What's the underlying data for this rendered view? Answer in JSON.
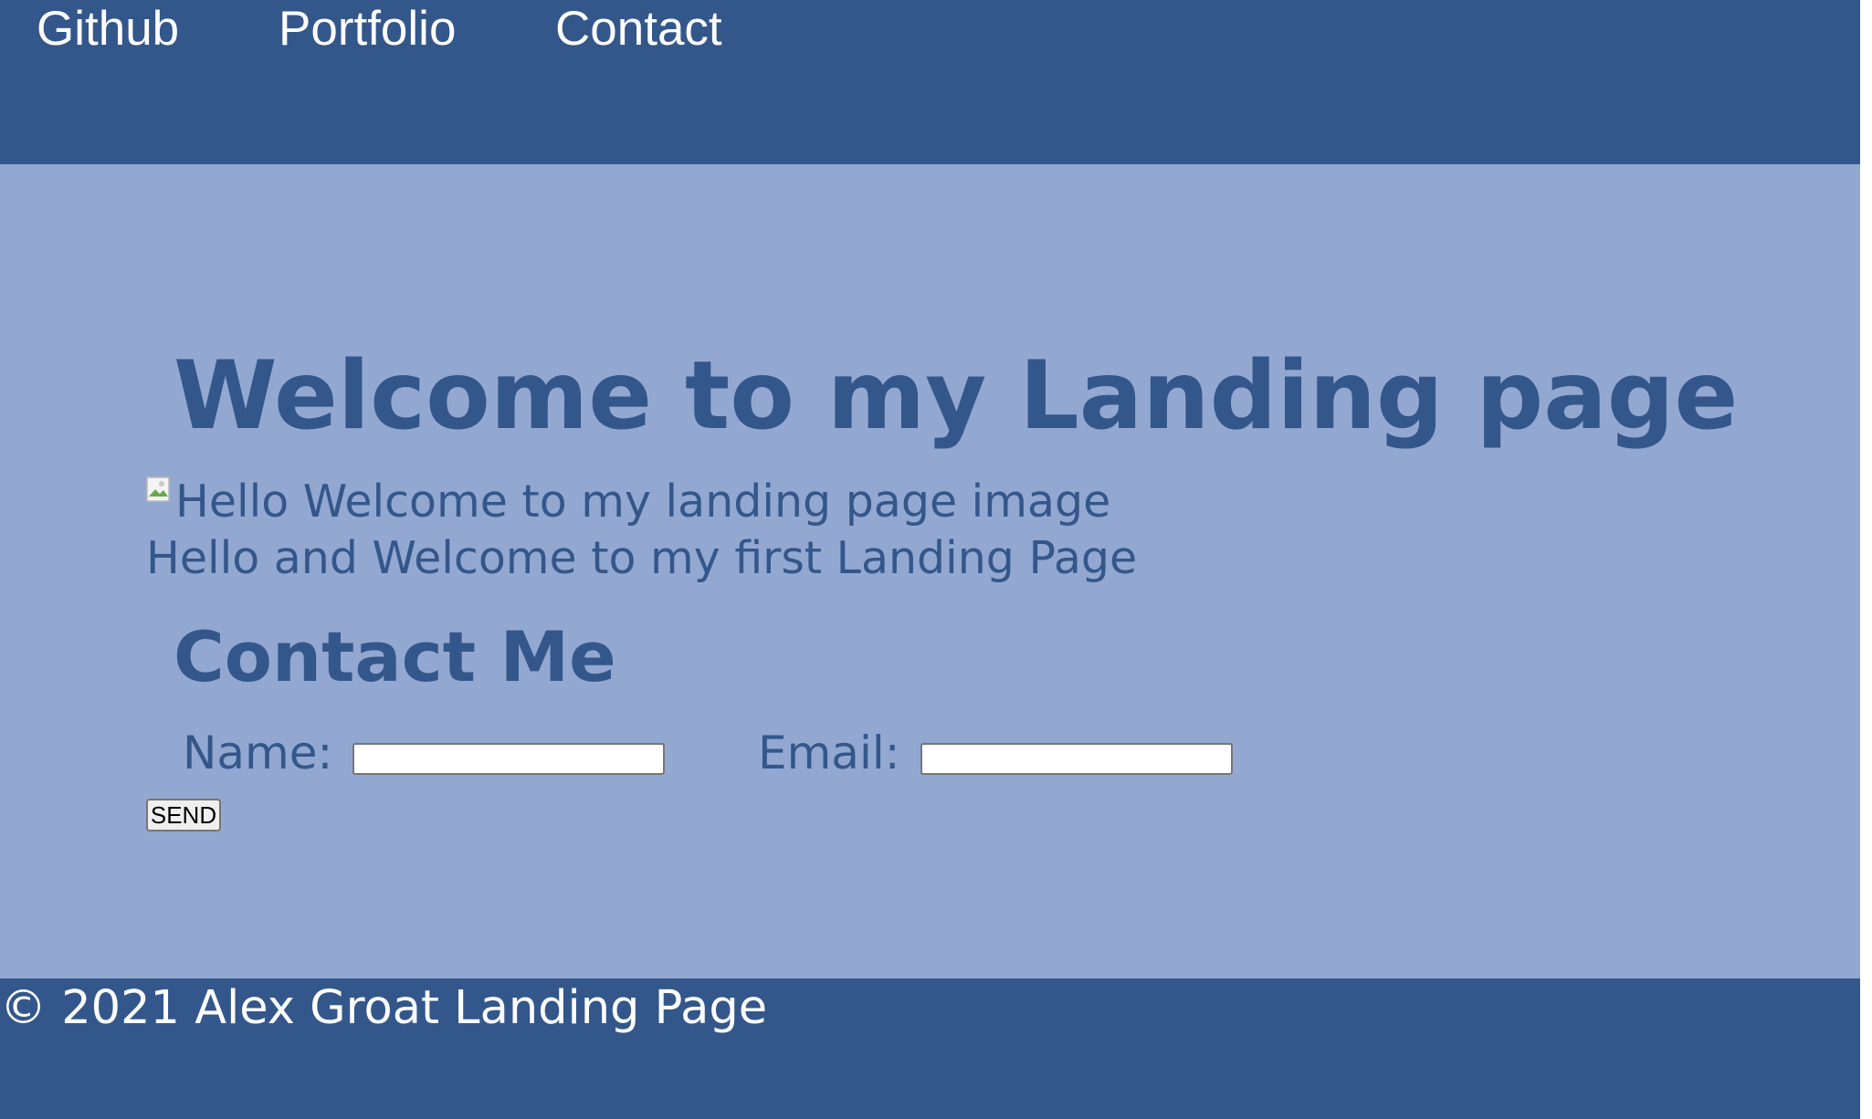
{
  "nav": {
    "links": [
      {
        "label": "Github"
      },
      {
        "label": "Portfolio"
      },
      {
        "label": "Contact"
      }
    ]
  },
  "hero": {
    "title": "Welcome to my Landing page",
    "image_alt": "Hello Welcome to my landing page image",
    "text": "Hello and Welcome to my first Landing Page"
  },
  "contact": {
    "title": "Contact Me",
    "name_label": "Name:",
    "name_value": "",
    "email_label": "Email:",
    "email_value": "",
    "send_label": "SEND"
  },
  "footer": {
    "text": "© 2021 Alex Groat Landing Page"
  },
  "colors": {
    "primary": "#34578b",
    "background": "#93a8d1",
    "nav_text": "#ffffff"
  },
  "icons": {
    "hero_image": "broken-image-icon"
  }
}
